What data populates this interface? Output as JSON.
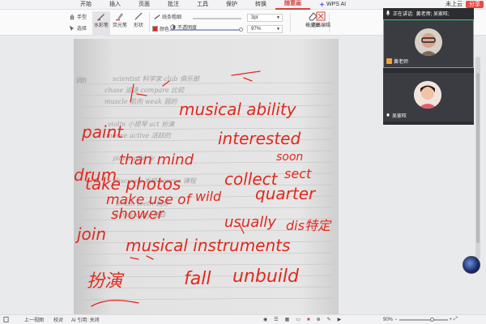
{
  "menu": {
    "items": [
      "开始",
      "插入",
      "页面",
      "批注",
      "工具",
      "保护",
      "转换",
      "随意画"
    ],
    "active_index": 7,
    "wps_ai": "WPS AI",
    "cloud": "未上云",
    "share": "分享"
  },
  "toolbar": {
    "hand": "手型",
    "select": "选择",
    "watercolor": "水彩笔",
    "highlighter": "荧光笔",
    "shape": "形状",
    "line_thickness": "线条粗细",
    "thickness_value": "3pt",
    "color": "颜色",
    "opacity": "不透明度",
    "opacity_value": "97%",
    "eraser": "橡皮擦",
    "exit": "退出编辑"
  },
  "video": {
    "speaking": "正在讲话:",
    "speaking_name": "黄老师; 吴家旺;",
    "participant1": "黄老师",
    "participant2": "吴家旺"
  },
  "status": {
    "page_nav": "上一视图",
    "proofread": "校对",
    "ai_quote": "AI 引用: 关闭",
    "zoom": "90%"
  },
  "annotations": {
    "musical_ability": "musical ability",
    "paint": "paint",
    "interested": "interested",
    "soon": "soon",
    "drum": "drum",
    "than_mind": "than mind",
    "take_photos": "take photos",
    "collect": "collect",
    "sect": "sect",
    "make_use_of": "make use of",
    "wild": "wild",
    "quarter": "quarter",
    "shower": "shower",
    "join": "join",
    "usually": "usually",
    "distinct": "dis特定",
    "musical_instruments": "musical instruments",
    "fall": "fall",
    "unbuild": "unbuild",
    "dance": "扮演"
  },
  "colors": {
    "ink": "#e0291e",
    "accent": "#d4423b",
    "speaking_border": "#2bd46b"
  }
}
